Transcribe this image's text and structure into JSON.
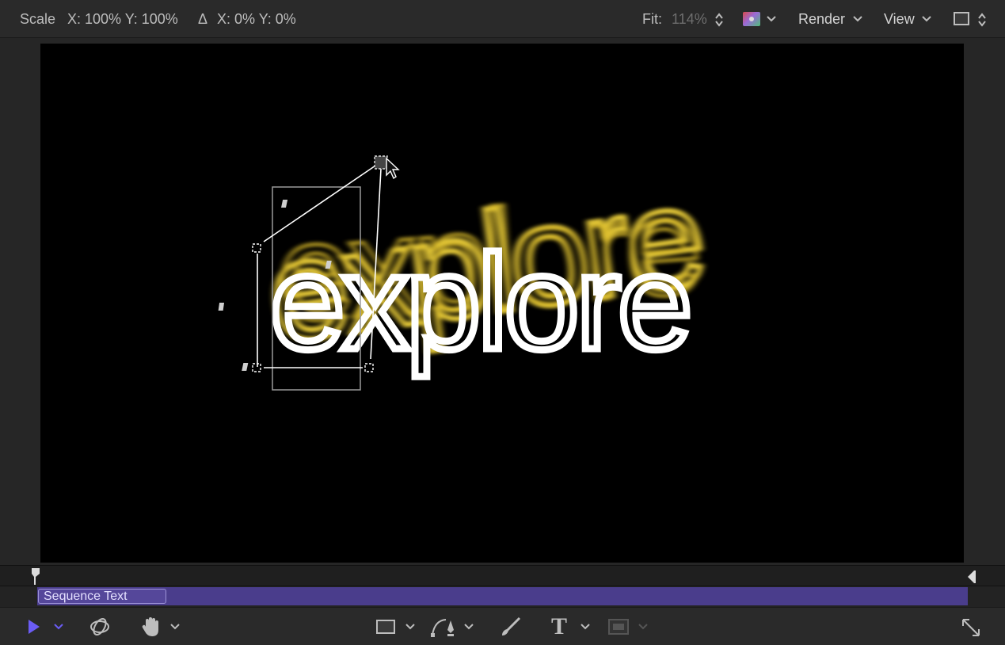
{
  "toolbar": {
    "scale_label": "Scale",
    "scale_values": "X: 100% Y: 100%",
    "delta_symbol": "Δ",
    "delta_values": "X: 0% Y: 0%",
    "fit_label": "Fit:",
    "fit_value": "114%",
    "render_label": "Render",
    "view_label": "View"
  },
  "canvas": {
    "text": "explore",
    "text_color": "#ffffff",
    "glow_color": "#f2d43a",
    "background": "#000000"
  },
  "timeline": {
    "track_label": "Sequence Text",
    "track_color": "#4a3d8c"
  },
  "bottom_tools": {
    "select_tool": "select-arrow-icon",
    "orbit_tool": "3d-orbit-icon",
    "pan_tool": "hand-icon",
    "shape_tool": "rectangle-icon",
    "pen_tool": "bezier-pen-icon",
    "paint_tool": "paint-stroke-icon",
    "text_tool": "T",
    "mask_tool": "mask-icon",
    "expand_tool": "expand-icon",
    "accent": "#6b5cf5"
  }
}
